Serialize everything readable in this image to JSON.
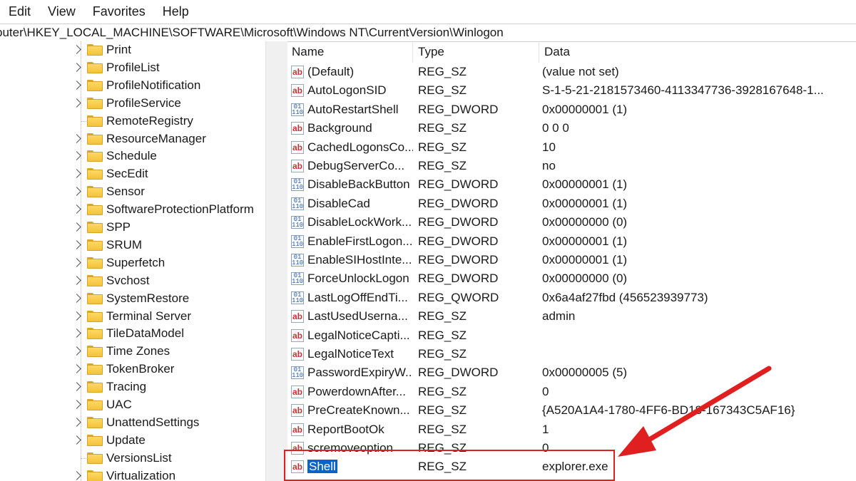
{
  "menubar": {
    "items": [
      "Edit",
      "View",
      "Favorites",
      "Help"
    ]
  },
  "address": "puter\\HKEY_LOCAL_MACHINE\\SOFTWARE\\Microsoft\\Windows NT\\CurrentVersion\\Winlogon",
  "tree": {
    "items": [
      {
        "label": "Print",
        "expandable": true
      },
      {
        "label": "ProfileList",
        "expandable": true
      },
      {
        "label": "ProfileNotification",
        "expandable": true
      },
      {
        "label": "ProfileService",
        "expandable": true
      },
      {
        "label": "RemoteRegistry",
        "expandable": false
      },
      {
        "label": "ResourceManager",
        "expandable": true
      },
      {
        "label": "Schedule",
        "expandable": true
      },
      {
        "label": "SecEdit",
        "expandable": true
      },
      {
        "label": "Sensor",
        "expandable": true
      },
      {
        "label": "SoftwareProtectionPlatform",
        "expandable": true
      },
      {
        "label": "SPP",
        "expandable": true
      },
      {
        "label": "SRUM",
        "expandable": true
      },
      {
        "label": "Superfetch",
        "expandable": true
      },
      {
        "label": "Svchost",
        "expandable": true
      },
      {
        "label": "SystemRestore",
        "expandable": true
      },
      {
        "label": "Terminal Server",
        "expandable": true
      },
      {
        "label": "TileDataModel",
        "expandable": true
      },
      {
        "label": "Time Zones",
        "expandable": true
      },
      {
        "label": "TokenBroker",
        "expandable": true
      },
      {
        "label": "Tracing",
        "expandable": true
      },
      {
        "label": "UAC",
        "expandable": true
      },
      {
        "label": "UnattendSettings",
        "expandable": true
      },
      {
        "label": "Update",
        "expandable": true
      },
      {
        "label": "VersionsList",
        "expandable": false
      },
      {
        "label": "Virtualization",
        "expandable": true
      }
    ]
  },
  "columns": {
    "name": "Name",
    "type": "Type",
    "data": "Data"
  },
  "values": [
    {
      "name": "(Default)",
      "type": "REG_SZ",
      "data": "(value not set)",
      "icon": "string-value-icon"
    },
    {
      "name": "AutoLogonSID",
      "type": "REG_SZ",
      "data": "S-1-5-21-2181573460-4113347736-3928167648-1...",
      "icon": "string-value-icon"
    },
    {
      "name": "AutoRestartShell",
      "type": "REG_DWORD",
      "data": "0x00000001 (1)",
      "icon": "binary-value-icon"
    },
    {
      "name": "Background",
      "type": "REG_SZ",
      "data": "0 0 0",
      "icon": "string-value-icon"
    },
    {
      "name": "CachedLogonsCo...",
      "type": "REG_SZ",
      "data": "10",
      "icon": "string-value-icon"
    },
    {
      "name": "DebugServerCo...",
      "type": "REG_SZ",
      "data": "no",
      "icon": "string-value-icon"
    },
    {
      "name": "DisableBackButton",
      "type": "REG_DWORD",
      "data": "0x00000001 (1)",
      "icon": "binary-value-icon"
    },
    {
      "name": "DisableCad",
      "type": "REG_DWORD",
      "data": "0x00000001 (1)",
      "icon": "binary-value-icon"
    },
    {
      "name": "DisableLockWork...",
      "type": "REG_DWORD",
      "data": "0x00000000 (0)",
      "icon": "binary-value-icon"
    },
    {
      "name": "EnableFirstLogon...",
      "type": "REG_DWORD",
      "data": "0x00000001 (1)",
      "icon": "binary-value-icon"
    },
    {
      "name": "EnableSIHostInte...",
      "type": "REG_DWORD",
      "data": "0x00000001 (1)",
      "icon": "binary-value-icon"
    },
    {
      "name": "ForceUnlockLogon",
      "type": "REG_DWORD",
      "data": "0x00000000 (0)",
      "icon": "binary-value-icon"
    },
    {
      "name": "LastLogOffEndTi...",
      "type": "REG_QWORD",
      "data": "0x6a4af27fbd (456523939773)",
      "icon": "binary-value-icon"
    },
    {
      "name": "LastUsedUserna...",
      "type": "REG_SZ",
      "data": "admin",
      "icon": "string-value-icon"
    },
    {
      "name": "LegalNoticeCapti...",
      "type": "REG_SZ",
      "data": "",
      "icon": "string-value-icon"
    },
    {
      "name": "LegalNoticeText",
      "type": "REG_SZ",
      "data": "",
      "icon": "string-value-icon"
    },
    {
      "name": "PasswordExpiryW...",
      "type": "REG_DWORD",
      "data": "0x00000005 (5)",
      "icon": "binary-value-icon"
    },
    {
      "name": "PowerdownAfter...",
      "type": "REG_SZ",
      "data": "0",
      "icon": "string-value-icon"
    },
    {
      "name": "PreCreateKnown...",
      "type": "REG_SZ",
      "data": "{A520A1A4-1780-4FF6-BD18-167343C5AF16}",
      "icon": "string-value-icon"
    },
    {
      "name": "ReportBootOk",
      "type": "REG_SZ",
      "data": "1",
      "icon": "string-value-icon"
    },
    {
      "name": "scremoveoption",
      "type": "REG_SZ",
      "data": "0",
      "icon": "string-value-icon"
    },
    {
      "name": "Shell",
      "type": "REG_SZ",
      "data": "explorer.exe",
      "icon": "string-value-icon",
      "selected": true
    }
  ],
  "colors": {
    "selection": "#0a64c8",
    "annotation": "#e02020",
    "folder": "#f2c23a"
  }
}
